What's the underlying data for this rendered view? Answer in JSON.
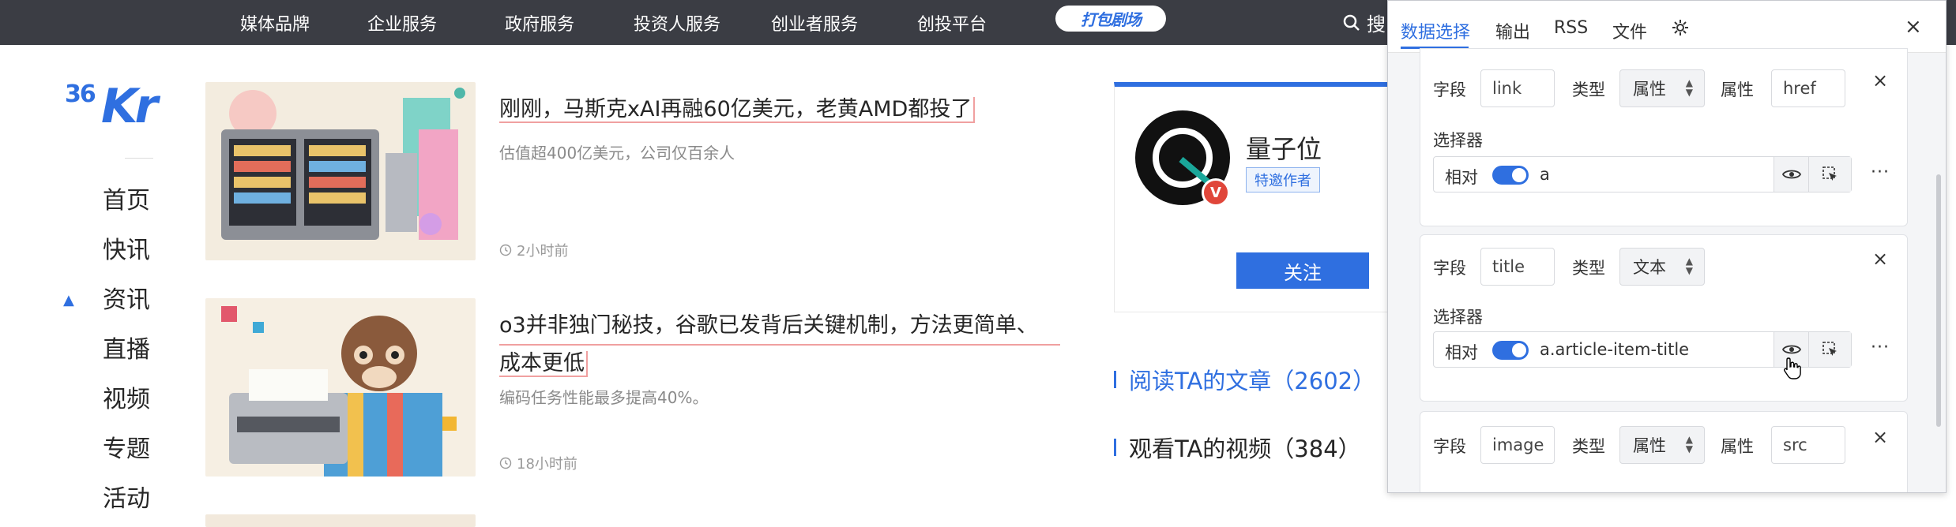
{
  "topnav": {
    "items": [
      "媒体品牌",
      "企业服务",
      "政府服务",
      "投资人服务",
      "创业者服务",
      "创投平台"
    ],
    "brand_pill": "打包剧场",
    "search_label": "搜"
  },
  "logo": {
    "num": "36",
    "kr": "Kr"
  },
  "leftnav": {
    "items": [
      "首页",
      "快讯",
      "资讯",
      "直播",
      "视频",
      "专题",
      "活动"
    ],
    "active_index": 2
  },
  "articles": [
    {
      "title": "刚刚，马斯克xAI再融60亿美元，老黄AMD都投了",
      "subtitle": "估值超400亿美元，公司仅百余人",
      "time": "2小时前"
    },
    {
      "title_line1": "o3并非独门秘技，谷歌已发背后关键机制，方法更简单、",
      "title_line2": "成本更低",
      "subtitle": "编码任务性能最多提高40%。",
      "time": "18小时前"
    }
  ],
  "author": {
    "name": "量子位",
    "badge": "特邀作者",
    "follow_label": "关注",
    "avatar_badge": "V"
  },
  "side_links": {
    "articles": "阅读TA的文章（2602）",
    "videos": "观看TA的视频（384）"
  },
  "panel": {
    "tabs": [
      "数据选择",
      "输出",
      "RSS",
      "文件"
    ],
    "active_tab": "数据选择",
    "close": "×",
    "labels": {
      "field": "字段",
      "type": "类型",
      "attr": "属性",
      "selector": "选择器",
      "relative": "相对",
      "more": "···",
      "remove": "×"
    },
    "rules": [
      {
        "field": "link",
        "type": "属性",
        "attr": "href",
        "selector": "a"
      },
      {
        "field": "title",
        "type": "文本",
        "selector": "a.article-item-title"
      },
      {
        "field": "image",
        "type": "属性",
        "attr": "src"
      }
    ]
  },
  "colors": {
    "accent": "#2f6fe0",
    "topbar": "#3b3d44",
    "highlight": "#f0a0a0"
  }
}
